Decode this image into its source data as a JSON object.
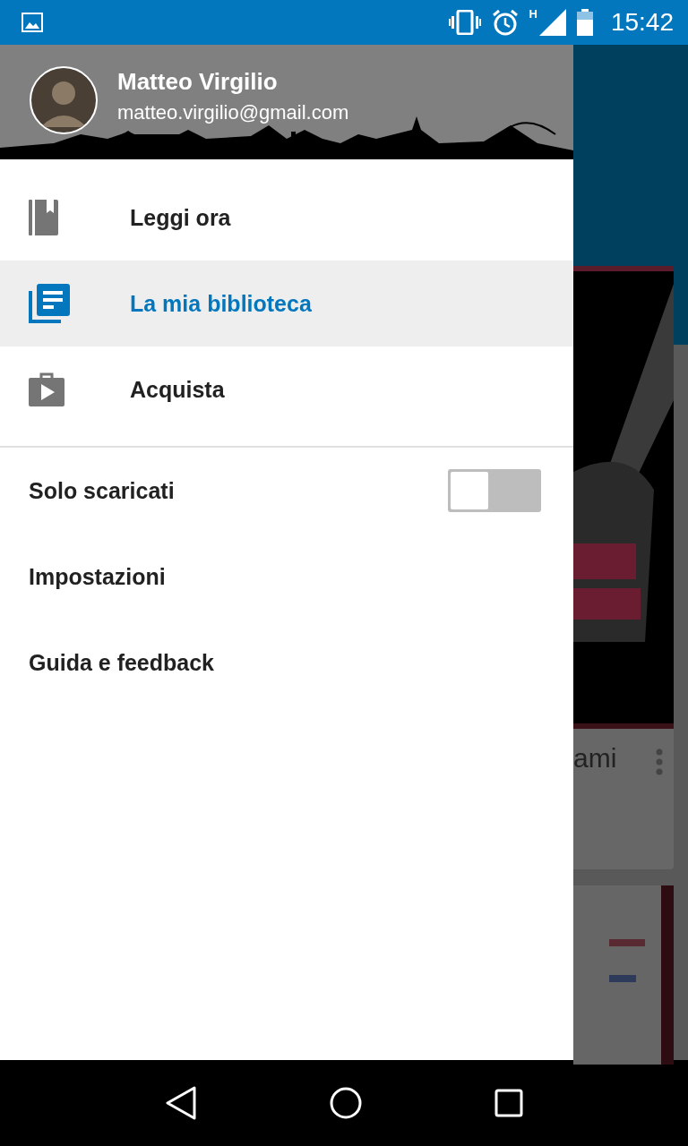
{
  "status_bar": {
    "network_type": "H",
    "time": "15:42"
  },
  "account": {
    "name": "Matteo Virgilio",
    "email": "matteo.virgilio@gmail.com"
  },
  "nav_items": [
    {
      "label": "Leggi ora",
      "kind": "read",
      "selected": false
    },
    {
      "label": "La mia biblioteca",
      "kind": "library",
      "selected": true
    },
    {
      "label": "Acquista",
      "kind": "shop",
      "selected": false
    }
  ],
  "settings": [
    {
      "label": "Solo scaricati",
      "kind": "toggle",
      "on": false
    },
    {
      "label": "Impostazioni",
      "kind": "link"
    },
    {
      "label": "Guida e feedback",
      "kind": "link"
    }
  ],
  "background": {
    "book_title": "ami"
  }
}
